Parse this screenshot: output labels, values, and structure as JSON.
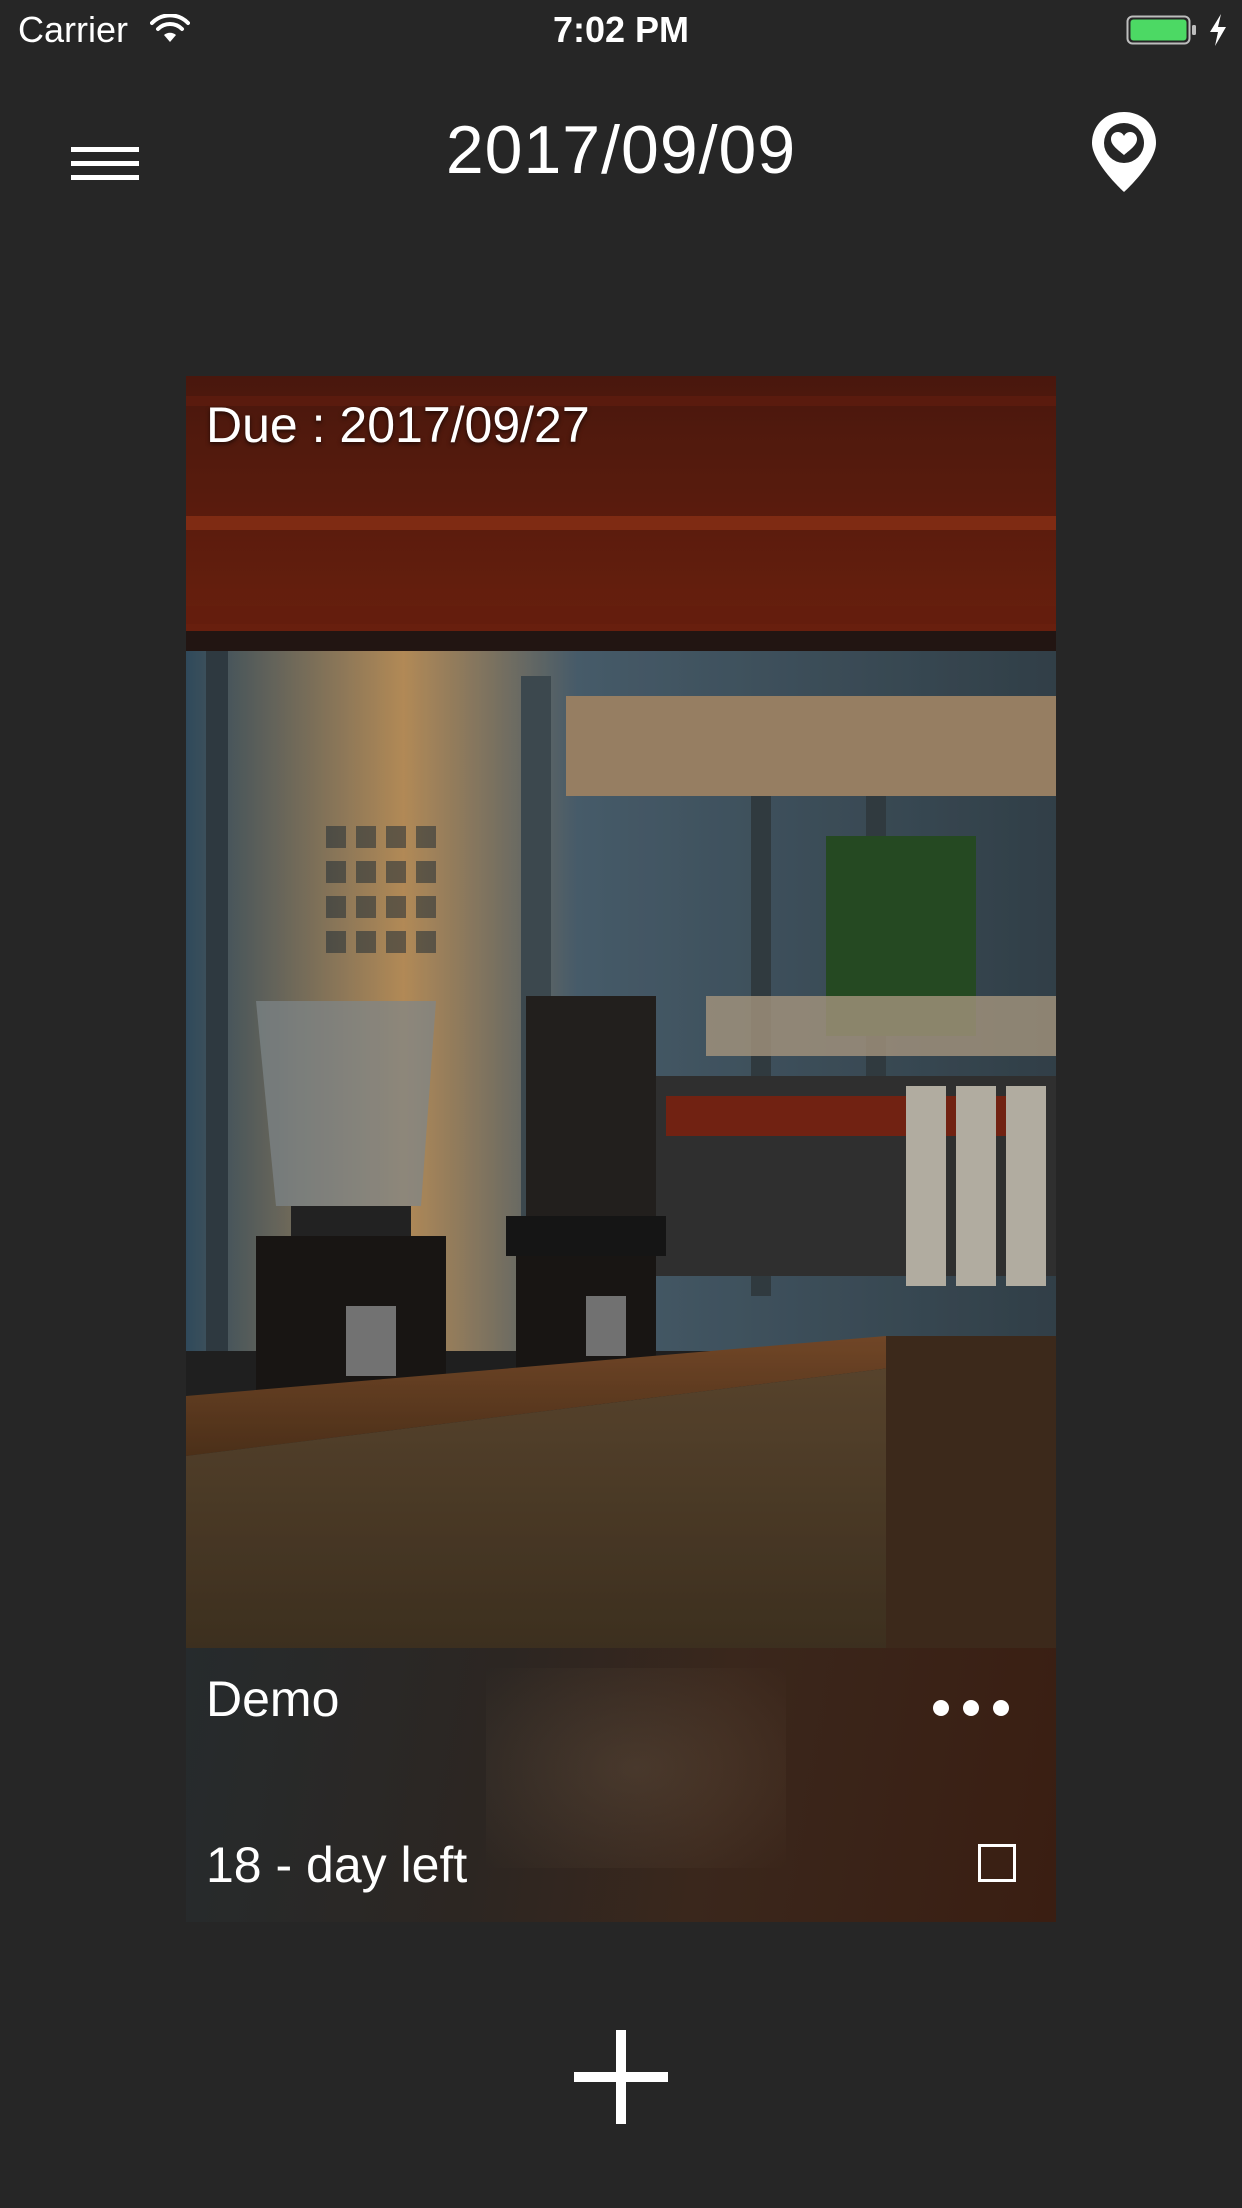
{
  "status_bar": {
    "carrier": "Carrier",
    "time": "7:02 PM",
    "battery_color": "#4cd964"
  },
  "nav": {
    "title": "2017/09/09",
    "left_icon": "hamburger-menu-icon",
    "right_icon": "location-heart-pin-icon"
  },
  "card": {
    "due_label": "Due : 2017/09/27",
    "name": "Demo",
    "days_left": "18 - day left",
    "more_icon": "ellipsis-icon",
    "checkbox_checked": false
  },
  "add_icon": "plus-icon",
  "colors": {
    "background": "#262626",
    "text": "#ffffff"
  }
}
